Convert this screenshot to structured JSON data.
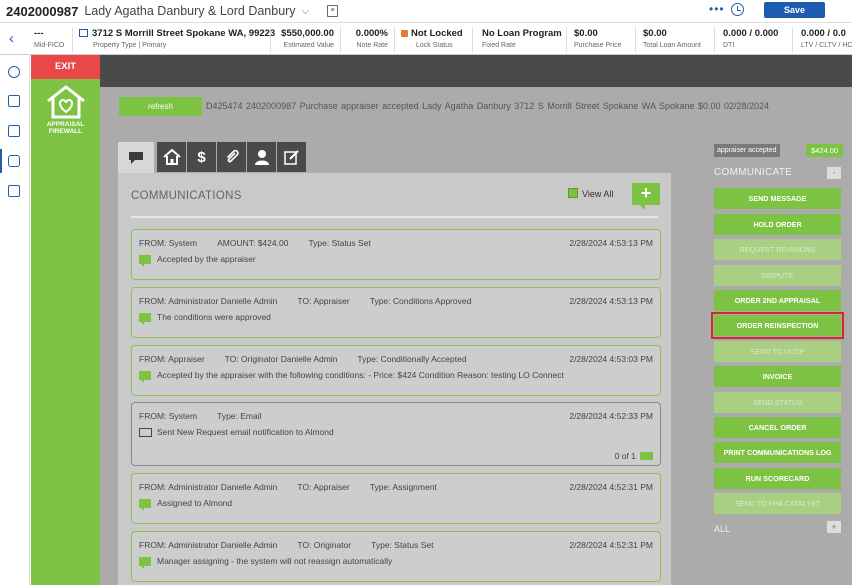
{
  "header": {
    "loan_number": "2402000987",
    "borrower": "Lady Agatha Danbury & Lord Danbury",
    "save_label": "Save"
  },
  "infobar": [
    {
      "value": "---",
      "label": "Mid-FICO"
    },
    {
      "value": "3712 S Morrill Street Spokane WA, 99223",
      "label": "Property Type | Primary"
    },
    {
      "value": "$550,000.00",
      "label": "Estimated Value"
    },
    {
      "value": "0.000%",
      "label": "Note Rate"
    },
    {
      "value": "Not Locked",
      "label": "Lock Status"
    },
    {
      "value": "No Loan Program",
      "label": "Fixed Rate"
    },
    {
      "value": "$0.00",
      "label": "Purchase Price"
    },
    {
      "value": "$0.00",
      "label": "Total Loan Amount"
    },
    {
      "value": "0.000 / 0.000",
      "label": "DTI"
    },
    {
      "value": "0.000 / 0.0",
      "label": "LTV / CLTV / HC"
    }
  ],
  "sidebar": {
    "exit_label": "EXIT",
    "logo_line1": "APPRAISAL",
    "logo_line2": "FIREWALL"
  },
  "order": {
    "refresh_label": "refresh",
    "summary": "D425474  2402000987  Purchase  appraiser accepted  Lady Agatha  Danbury  3712 S Morrill Street  Spokane  WA  Spokane  $0.00  02/28/2024"
  },
  "tabs": [
    {
      "icon": "chat-icon",
      "glyph": "▬"
    },
    {
      "icon": "home-icon",
      "glyph": "⌂"
    },
    {
      "icon": "dollar-icon",
      "glyph": "$"
    },
    {
      "icon": "paperclip-icon",
      "glyph": "⌇"
    },
    {
      "icon": "person-icon",
      "glyph": "●"
    },
    {
      "icon": "edit-icon",
      "glyph": "✎"
    }
  ],
  "communications": {
    "title": "COMMUNICATIONS",
    "view_all_label": "View All",
    "add_label": "+",
    "messages": [
      {
        "fields": [
          "FROM: System",
          "AMOUNT: $424.00",
          "Type: Status Set"
        ],
        "time": "2/28/2024 4:53:13 PM",
        "body": "Accepted by the appraiser",
        "kind": "chat"
      },
      {
        "fields": [
          "FROM: Administrator Danielle Admin",
          "TO: Appraiser",
          "Type: Conditions Approved"
        ],
        "time": "2/28/2024 4:53:13 PM",
        "body": "The conditions were approved",
        "kind": "chat"
      },
      {
        "fields": [
          "FROM: Appraiser",
          "TO: Originator Danielle Admin",
          "Type: Conditionally Accepted"
        ],
        "time": "2/28/2024 4:53:03 PM",
        "body": "Accepted by the appraiser with the following conditions: - Price: $424 Condition Reason: testing LO Connect",
        "kind": "chat"
      },
      {
        "fields": [
          "FROM: System",
          "Type: Email"
        ],
        "time": "2/28/2024 4:52:33 PM",
        "body": "Sent New Request email notification to Almond",
        "kind": "email",
        "footer": "0 of 1"
      },
      {
        "fields": [
          "FROM: Administrator Danielle Admin",
          "TO: Appraiser",
          "Type: Assignment"
        ],
        "time": "2/28/2024 4:52:31 PM",
        "body": "Assigned to Almond",
        "kind": "chat"
      },
      {
        "fields": [
          "FROM: Administrator Danielle Admin",
          "TO: Originator",
          "Type: Status Set"
        ],
        "time": "2/28/2024 4:52:31 PM",
        "body": "Manager assigning - the system will not reassign automatically",
        "kind": "chat"
      }
    ]
  },
  "actions": {
    "status": "appraiser accepted",
    "amount": "$424.00",
    "communicate_label": "COMMUNICATE",
    "collapse_label": "-",
    "all_label": "ALL",
    "all_expand_label": "+",
    "buttons": [
      {
        "label": "SEND MESSAGE",
        "enabled": true
      },
      {
        "label": "HOLD ORDER",
        "enabled": true
      },
      {
        "label": "REQUEST REVISIONS",
        "enabled": false
      },
      {
        "label": "DISPUTE",
        "enabled": false
      },
      {
        "label": "ORDER 2ND APPRAISAL",
        "enabled": true
      },
      {
        "label": "ORDER REINSPECTION",
        "enabled": true,
        "highlight": true
      },
      {
        "label": "SEND TO UCDP",
        "enabled": false
      },
      {
        "label": "INVOICE",
        "enabled": true
      },
      {
        "label": "SEND STATUS",
        "enabled": false
      },
      {
        "label": "CANCEL ORDER",
        "enabled": true
      },
      {
        "label": "PRINT COMMUNICATIONS LOG",
        "enabled": true
      },
      {
        "label": "RUN SCORECARD",
        "enabled": true
      },
      {
        "label": "SEND TO FHA CATALYST",
        "enabled": false
      }
    ]
  }
}
